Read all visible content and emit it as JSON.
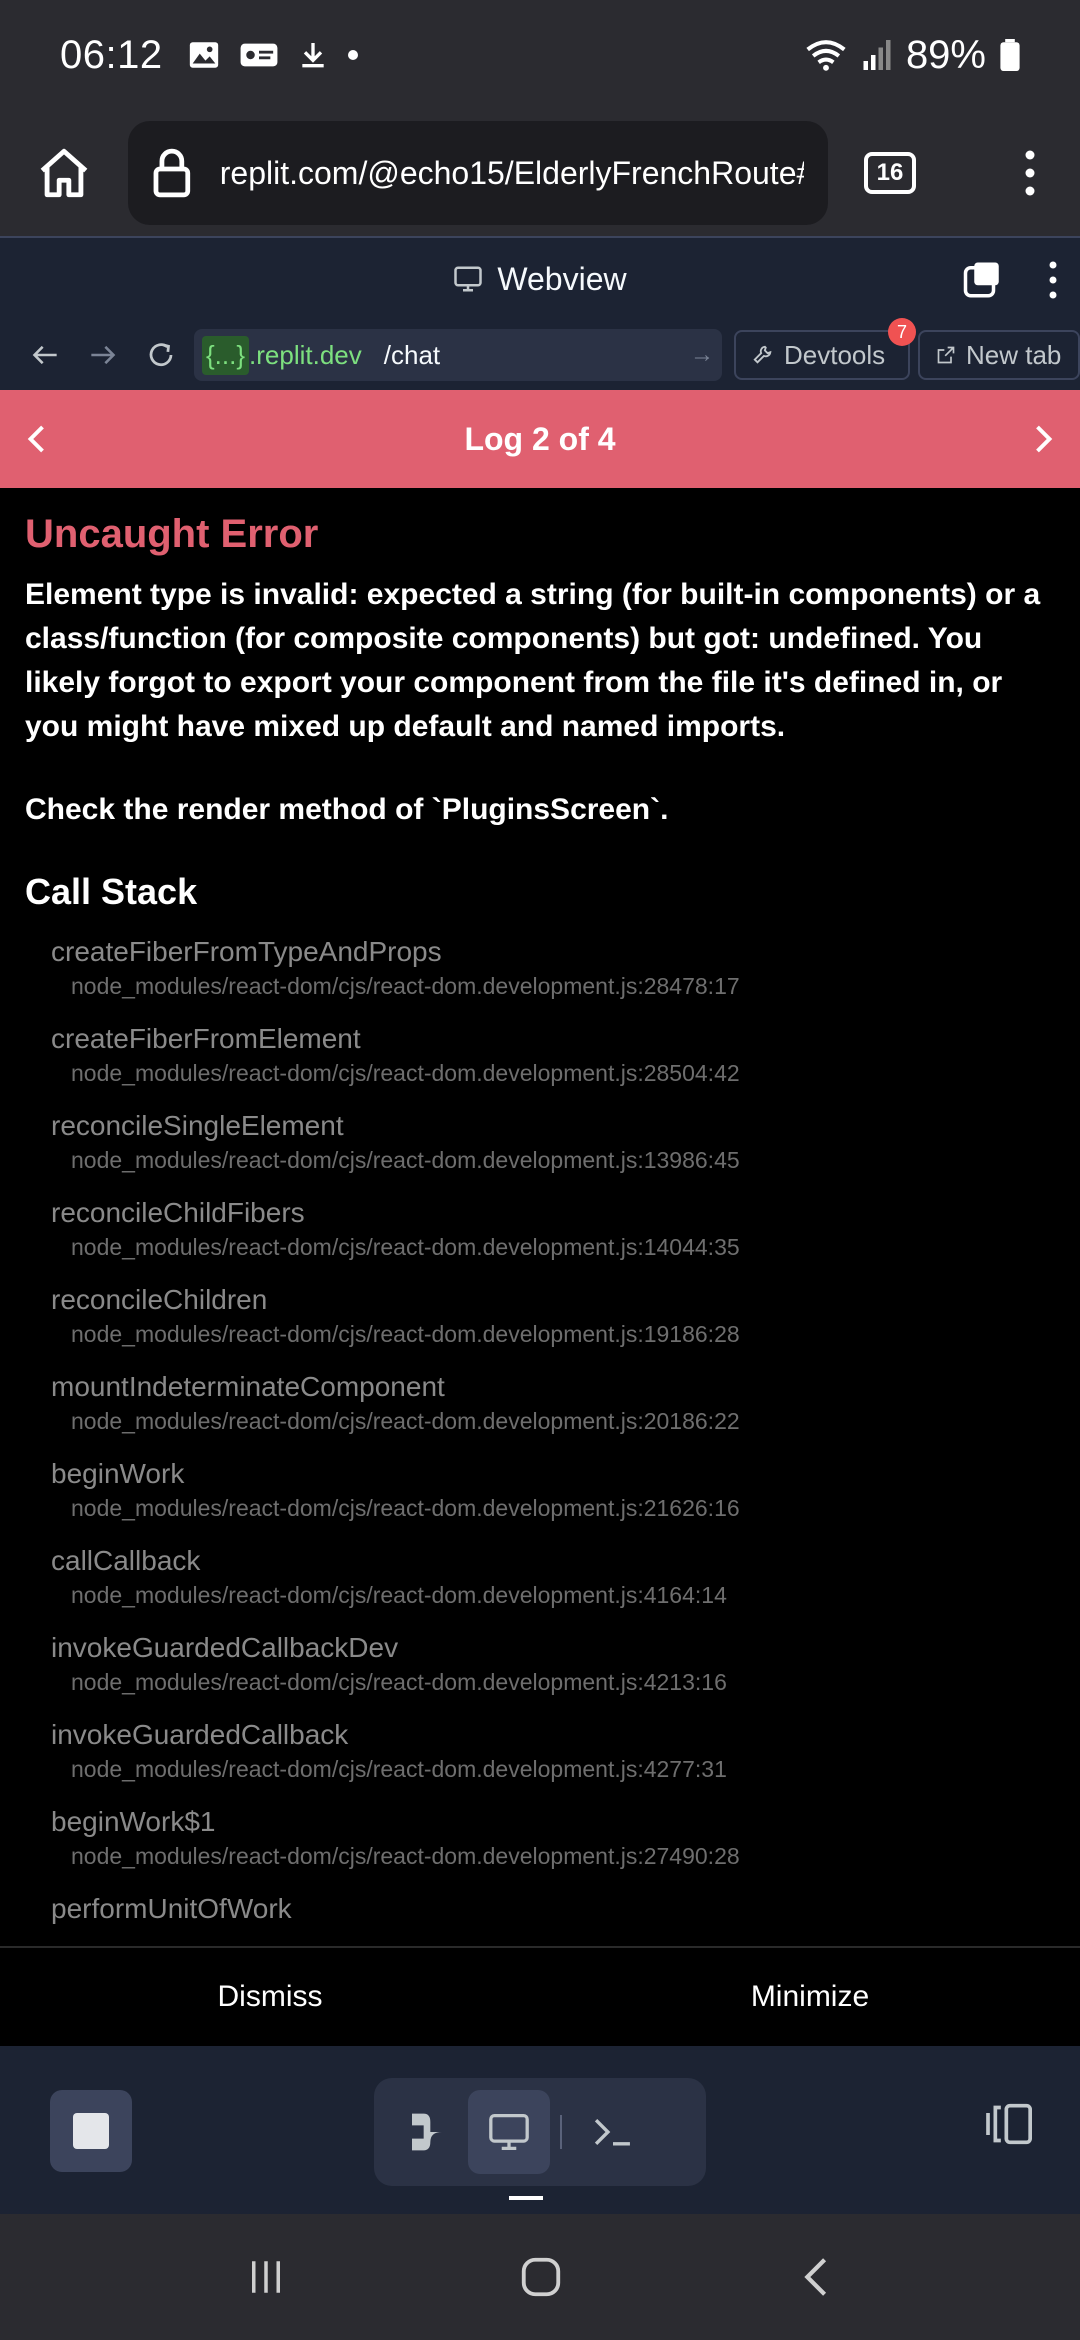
{
  "status_bar": {
    "time": "06:12",
    "battery": "89%"
  },
  "browser": {
    "url": "replit.com/@echo15/ElderlyFrenchRoute#R",
    "tab_count": "16"
  },
  "webview": {
    "title": "Webview",
    "address": {
      "host_token": "{...}",
      "host": ".replit.dev",
      "path": "/chat"
    },
    "devtools_label": "Devtools",
    "devtools_badge": "7",
    "new_tab_label": "New tab"
  },
  "error_overlay": {
    "log_title": "Log 2 of 4",
    "error_title": "Uncaught Error",
    "message": "Element type is invalid: expected a string (for built-in components) or a class/function (for composite components) but got: undefined. You likely forgot to export your component from the file it's defined in, or you might have mixed up default and named imports.",
    "check_text": "Check the render method of `PluginsScreen`.",
    "call_stack_title": "Call Stack",
    "frames": [
      {
        "fn": "createFiberFromTypeAndProps",
        "loc": "node_modules/react-dom/cjs/react-dom.development.js:28478:17"
      },
      {
        "fn": "createFiberFromElement",
        "loc": "node_modules/react-dom/cjs/react-dom.development.js:28504:42"
      },
      {
        "fn": "reconcileSingleElement",
        "loc": "node_modules/react-dom/cjs/react-dom.development.js:13986:45"
      },
      {
        "fn": "reconcileChildFibers",
        "loc": "node_modules/react-dom/cjs/react-dom.development.js:14044:35"
      },
      {
        "fn": "reconcileChildren",
        "loc": "node_modules/react-dom/cjs/react-dom.development.js:19186:28"
      },
      {
        "fn": "mountIndeterminateComponent",
        "loc": "node_modules/react-dom/cjs/react-dom.development.js:20186:22"
      },
      {
        "fn": "beginWork",
        "loc": "node_modules/react-dom/cjs/react-dom.development.js:21626:16"
      },
      {
        "fn": "callCallback",
        "loc": "node_modules/react-dom/cjs/react-dom.development.js:4164:14"
      },
      {
        "fn": "invokeGuardedCallbackDev",
        "loc": "node_modules/react-dom/cjs/react-dom.development.js:4213:16"
      },
      {
        "fn": "invokeGuardedCallback",
        "loc": "node_modules/react-dom/cjs/react-dom.development.js:4277:31"
      },
      {
        "fn": "beginWork$1",
        "loc": "node_modules/react-dom/cjs/react-dom.development.js:27490:28"
      },
      {
        "fn": "performUnitOfWork",
        "loc": ""
      }
    ],
    "dismiss_label": "Dismiss",
    "minimize_label": "Minimize"
  },
  "colors": {
    "error_accent": "#e06070",
    "host_green": "#7de07f",
    "badge_red": "#f05252"
  },
  "icons": [
    "home-icon",
    "lock-icon",
    "kebab-menu-icon",
    "monitor-icon",
    "layers-icon",
    "back-arrow-icon",
    "forward-arrow-icon",
    "reload-icon",
    "wrench-icon",
    "external-link-icon",
    "chevron-left-icon",
    "chevron-right-icon",
    "stop-icon",
    "agent-icon",
    "terminal-icon",
    "panel-toggle-icon"
  ]
}
